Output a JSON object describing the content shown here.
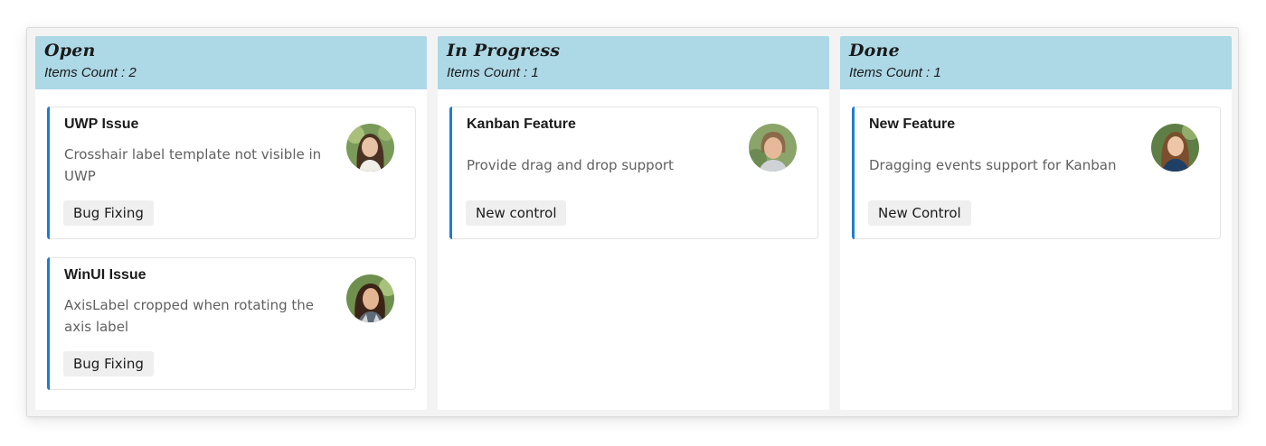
{
  "columns": [
    {
      "title": "Open",
      "count_text": "Items Count : 2",
      "cards": [
        {
          "title": "UWP Issue",
          "description": "Crosshair label template not visible in UWP",
          "tag": "Bug Fixing",
          "avatar_icon": "avatar-woman-smiling"
        },
        {
          "title": "WinUI Issue",
          "description": "AxisLabel cropped when rotating the axis label",
          "tag": "Bug Fixing",
          "avatar_icon": "avatar-woman-dark-hair"
        }
      ]
    },
    {
      "title": "In Progress",
      "count_text": "Items Count : 1",
      "cards": [
        {
          "title": "Kanban Feature",
          "description": "Provide drag and drop support",
          "tag": "New control",
          "avatar_icon": "avatar-woman-short-hair"
        }
      ]
    },
    {
      "title": "Done",
      "count_text": "Items Count : 1",
      "cards": [
        {
          "title": "New Feature",
          "description": "Dragging events support for Kanban",
          "tag": "New Control",
          "avatar_icon": "avatar-woman-long-hair"
        }
      ]
    }
  ],
  "colors": {
    "header_background": "#add8e6",
    "card_accent": "#1f7ccf",
    "board_background": "#f3f3f3",
    "tag_background": "#efefef"
  }
}
